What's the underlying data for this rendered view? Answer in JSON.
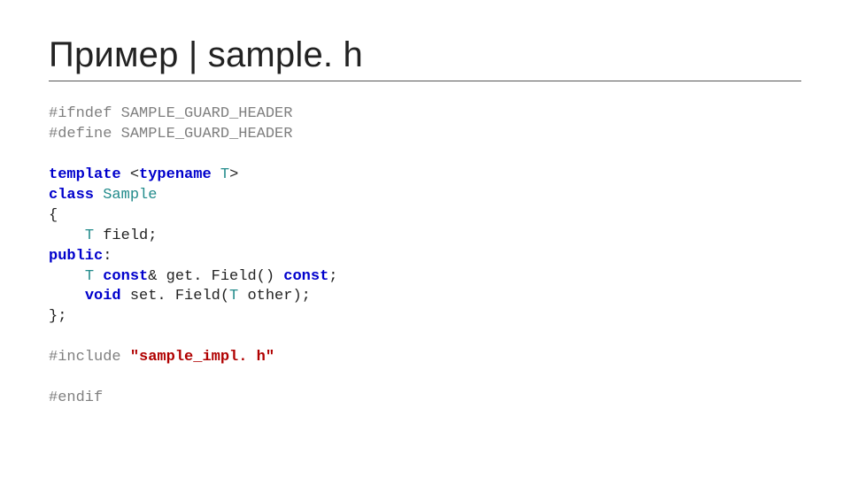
{
  "slide": {
    "title": "Пример | sample. h"
  },
  "code": {
    "l1": {
      "a": "#ifndef",
      "b": " SAMPLE_GUARD_HEADER"
    },
    "l2": {
      "a": "#define",
      "b": " SAMPLE_GUARD_HEADER"
    },
    "l3": "",
    "l4": {
      "a": "template",
      "b": " <",
      "c": "typename",
      "d": " ",
      "e": "T",
      "f": ">"
    },
    "l5": {
      "a": "class",
      "b": " ",
      "c": "Sample"
    },
    "l6": "{",
    "l7": {
      "a": "    ",
      "b": "T",
      "c": " field;"
    },
    "l8": {
      "a": "public",
      "b": ":"
    },
    "l9": {
      "a": "    ",
      "b": "T",
      "c": " ",
      "d": "const",
      "e": "& get. Field() ",
      "f": "const",
      "g": ";"
    },
    "l10": {
      "a": "    ",
      "b": "void",
      "c": " set. Field(",
      "d": "T",
      "e": " other);"
    },
    "l11": "};",
    "l12": "",
    "l13": {
      "a": "#include",
      "b": " ",
      "c": "\"sample_impl. h\""
    },
    "l14": "",
    "l15": "#endif"
  }
}
